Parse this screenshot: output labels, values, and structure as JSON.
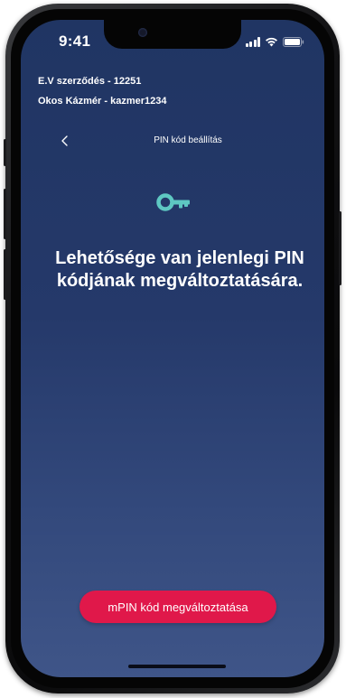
{
  "status_bar": {
    "time": "9:41"
  },
  "header": {
    "contract_line": "E.V szerződés - 12251",
    "user_line": "Okos Kázmér - kazmer1234"
  },
  "nav": {
    "back_icon": "chevron-left-icon",
    "title": "PIN kód beállítás"
  },
  "content": {
    "icon": "key-icon",
    "icon_color": "#5ec8c2",
    "message": "Lehetősége van jelenlegi PIN kódjának megváltoztatására."
  },
  "actions": {
    "change_pin_label": "mPIN kód megváltoztatása",
    "button_color": "#e0184a"
  },
  "theme": {
    "background_top": "#203563",
    "background_bottom": "#3f5588",
    "text": "#ffffff"
  }
}
